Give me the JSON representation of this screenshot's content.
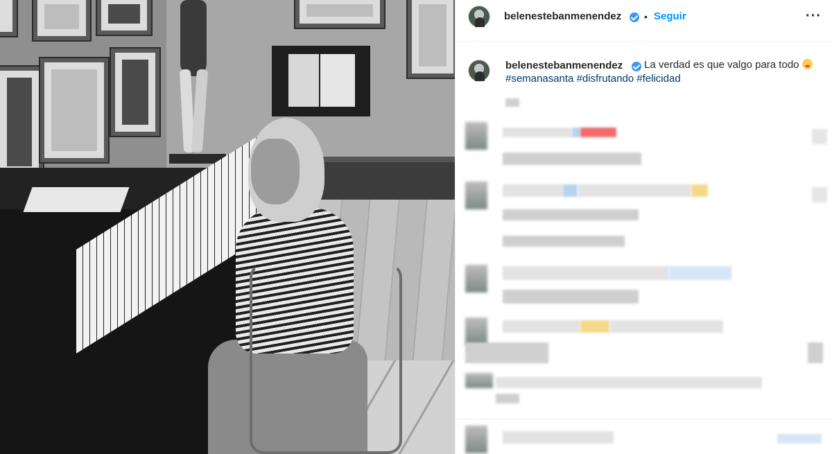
{
  "post": {
    "author": "belenestebanmenendez",
    "follow_label": "Seguir",
    "separator": "•",
    "more_label": "···",
    "caption": "La verdad es que valgo para todo",
    "hashtags": "#semanasanta #disfrutando #felicidad"
  },
  "colors": {
    "accent": "#0095f6",
    "hashtag": "#00376b",
    "verified": "#3897f0",
    "text": "#262626",
    "divider": "#efefef"
  },
  "icons": {
    "verified": "verified-badge-icon",
    "more": "more-options-icon",
    "emoji": "tongue-emoji-icon"
  }
}
